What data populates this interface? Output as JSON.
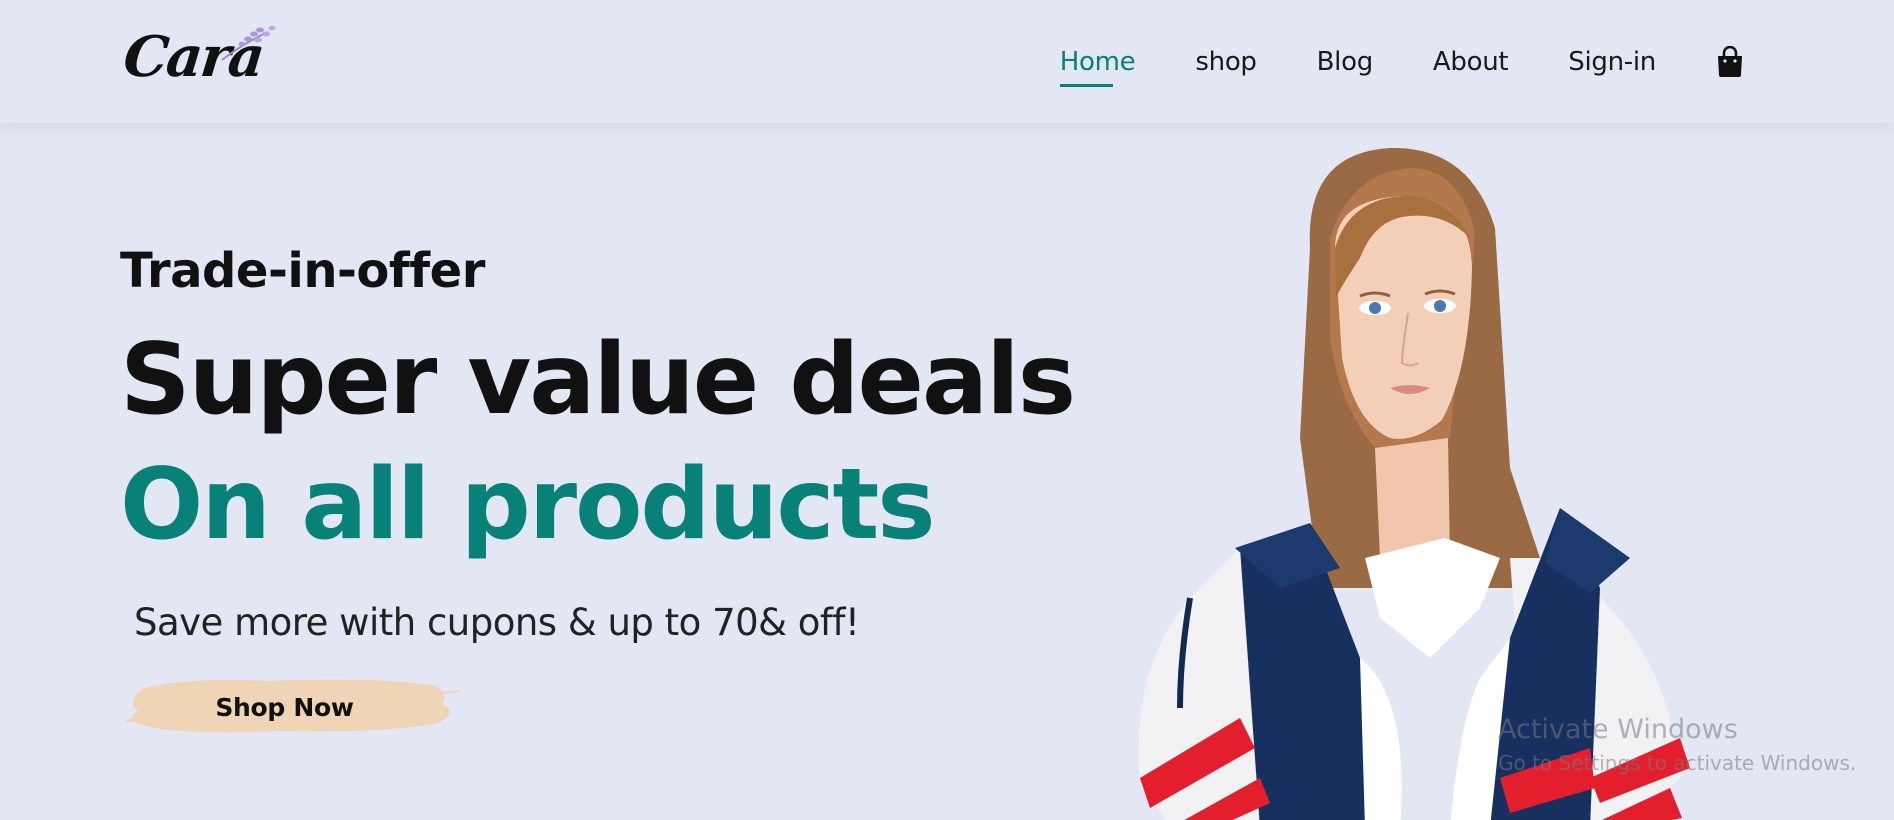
{
  "header": {
    "logo_text": "Cara",
    "nav": [
      {
        "label": "Home",
        "active": true
      },
      {
        "label": "shop",
        "active": false
      },
      {
        "label": "Blog",
        "active": false
      },
      {
        "label": "About",
        "active": false
      },
      {
        "label": "Sign-in",
        "active": false
      }
    ],
    "cart_icon": "shopping-bag-icon"
  },
  "hero": {
    "kicker": "Trade-in-offer",
    "title": "Super value deals",
    "subtitle": "On all products",
    "description": "Save more with cupons & up to 70& off!",
    "button_label": "Shop Now"
  },
  "overlay": {
    "line1": "Activate Windows",
    "line2": "Go to Settings to activate Windows."
  },
  "colors": {
    "background": "#e3e6f3",
    "accent": "#088178",
    "button_bg": "#f0d5b8",
    "text": "#111111"
  }
}
